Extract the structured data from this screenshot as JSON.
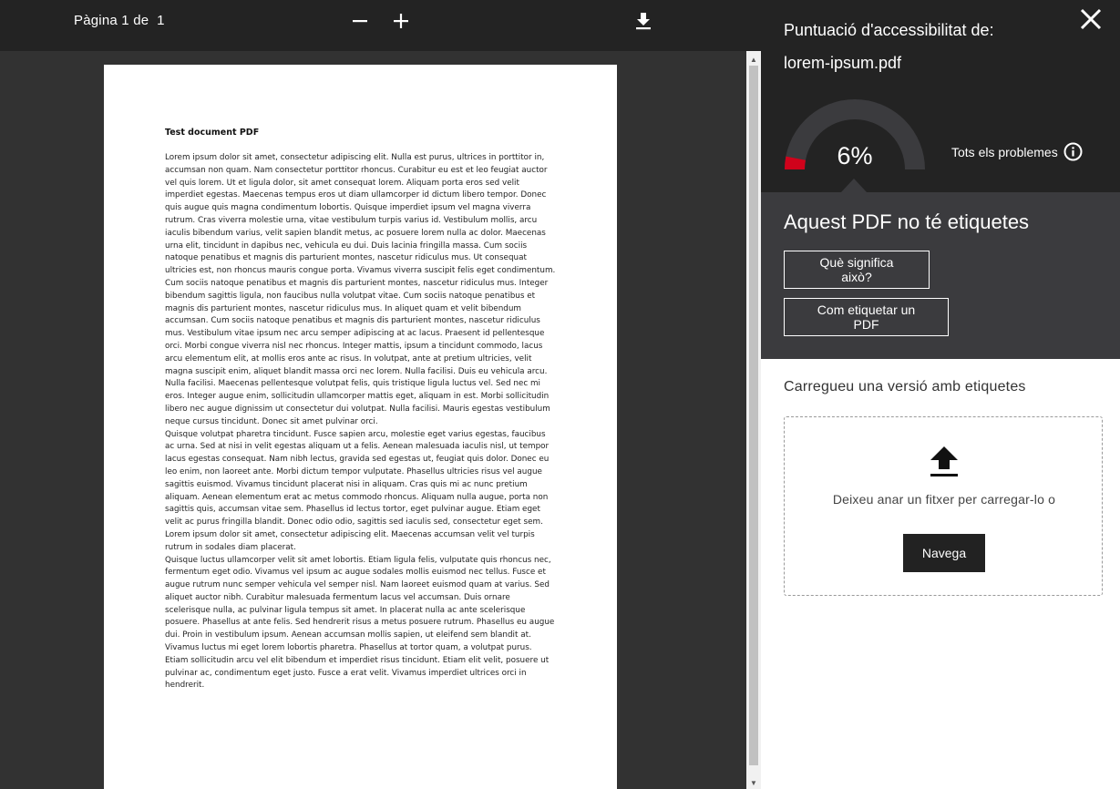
{
  "toolbar": {
    "page_word": "Pàgina",
    "current_page": "1",
    "of_word": "de",
    "total_pages": "1",
    "zoom_out_icon": "minus-icon",
    "zoom_in_icon": "plus-icon",
    "download_icon": "download-icon"
  },
  "document": {
    "title": "Test document PDF",
    "paragraphs": [
      "Lorem ipsum dolor sit amet, consectetur adipiscing elit. Nulla est purus, ultrices in porttitor in, accumsan non quam. Nam consectetur porttitor rhoncus. Curabitur eu est et leo feugiat auctor vel quis lorem. Ut et ligula dolor, sit amet consequat lorem. Aliquam porta eros sed velit imperdiet egestas. Maecenas tempus eros ut diam ullamcorper id dictum libero tempor. Donec quis augue quis magna condimentum lobortis. Quisque imperdiet ipsum vel magna viverra rutrum. Cras viverra molestie urna, vitae vestibulum turpis varius id. Vestibulum mollis, arcu iaculis bibendum varius, velit sapien blandit metus, ac posuere lorem nulla ac dolor. Maecenas urna elit, tincidunt in dapibus nec, vehicula eu dui. Duis lacinia fringilla massa. Cum sociis natoque penatibus et magnis dis parturient montes, nascetur ridiculus mus. Ut consequat ultricies est, non rhoncus mauris congue porta. Vivamus viverra suscipit felis eget condimentum. Cum sociis natoque penatibus et magnis dis parturient montes, nascetur ridiculus mus. Integer bibendum sagittis ligula, non faucibus nulla volutpat vitae. Cum sociis natoque penatibus et magnis dis parturient montes, nascetur ridiculus mus. In aliquet quam et velit bibendum accumsan. Cum sociis natoque penatibus et magnis dis parturient montes, nascetur ridiculus mus. Vestibulum vitae ipsum nec arcu semper adipiscing at ac lacus. Praesent id pellentesque orci. Morbi congue viverra nisl nec rhoncus. Integer mattis, ipsum a tincidunt commodo, lacus arcu elementum elit, at mollis eros ante ac risus. In volutpat, ante at pretium ultricies, velit magna suscipit enim, aliquet blandit massa orci nec lorem. Nulla facilisi. Duis eu vehicula arcu. Nulla facilisi. Maecenas pellentesque volutpat felis, quis tristique ligula luctus vel. Sed nec mi eros. Integer augue enim, sollicitudin ullamcorper mattis eget, aliquam in est. Morbi sollicitudin libero nec augue dignissim ut consectetur dui volutpat. Nulla facilisi. Mauris egestas vestibulum neque cursus tincidunt. Donec sit amet pulvinar orci.",
      "Quisque volutpat pharetra tincidunt. Fusce sapien arcu, molestie eget varius egestas, faucibus ac urna. Sed at nisi in velit egestas aliquam ut a felis. Aenean malesuada iaculis nisl, ut tempor lacus egestas consequat. Nam nibh lectus, gravida sed egestas ut, feugiat quis dolor. Donec eu leo enim, non laoreet ante. Morbi dictum tempor vulputate. Phasellus ultricies risus vel augue sagittis euismod. Vivamus tincidunt placerat nisi in aliquam. Cras quis mi ac nunc pretium aliquam. Aenean elementum erat ac metus commodo rhoncus. Aliquam nulla augue, porta non sagittis quis, accumsan vitae sem. Phasellus id lectus tortor, eget pulvinar augue. Etiam eget velit ac purus fringilla blandit. Donec odio odio, sagittis sed iaculis sed, consectetur eget sem. Lorem ipsum dolor sit amet, consectetur adipiscing elit. Maecenas accumsan velit vel turpis rutrum in sodales diam placerat.",
      "Quisque luctus ullamcorper velit sit amet lobortis. Etiam ligula felis, vulputate quis rhoncus nec, fermentum eget odio. Vivamus vel ipsum ac augue sodales mollis euismod nec tellus. Fusce et augue rutrum nunc semper vehicula vel semper nisl. Nam laoreet euismod quam at varius. Sed aliquet auctor nibh. Curabitur malesuada fermentum lacus vel accumsan. Duis ornare scelerisque nulla, ac pulvinar ligula tempus sit amet. In placerat nulla ac ante scelerisque posuere. Phasellus at ante felis. Sed hendrerit risus a metus posuere rutrum. Phasellus eu augue dui. Proin in vestibulum ipsum. Aenean accumsan mollis sapien, ut eleifend sem blandit at. Vivamus luctus mi eget lorem lobortis pharetra. Phasellus at tortor quam, a volutpat purus. Etiam sollicitudin arcu vel elit bibendum et imperdiet risus tincidunt. Etiam elit velit, posuere ut pulvinar ac, condimentum eget justo. Fusce a erat velit. Vivamus imperdiet ultrices orci in hendrerit."
    ]
  },
  "panel": {
    "title_line1": "Puntuació d'accessibilitat de:",
    "title_line2": "lorem-ipsum.pdf",
    "close_icon": "close-icon",
    "score_text": "6%",
    "score_fraction": 0.06,
    "gauge_track_color": "#3b3b3e",
    "gauge_fill_color": "#d0021b",
    "all_issues_label": "Tots els problemes",
    "info_icon": "info-icon",
    "status_heading": "Aquest PDF no té etiquetes",
    "what_button": "Què significa això?",
    "how_button": "Com etiquetar un PDF",
    "upload_label": "Carregueu una versió amb etiquetes",
    "upload_icon": "upload-icon",
    "drop_text": "Deixeu anar un fitxer per carregar-lo o",
    "browse_button": "Navega"
  }
}
